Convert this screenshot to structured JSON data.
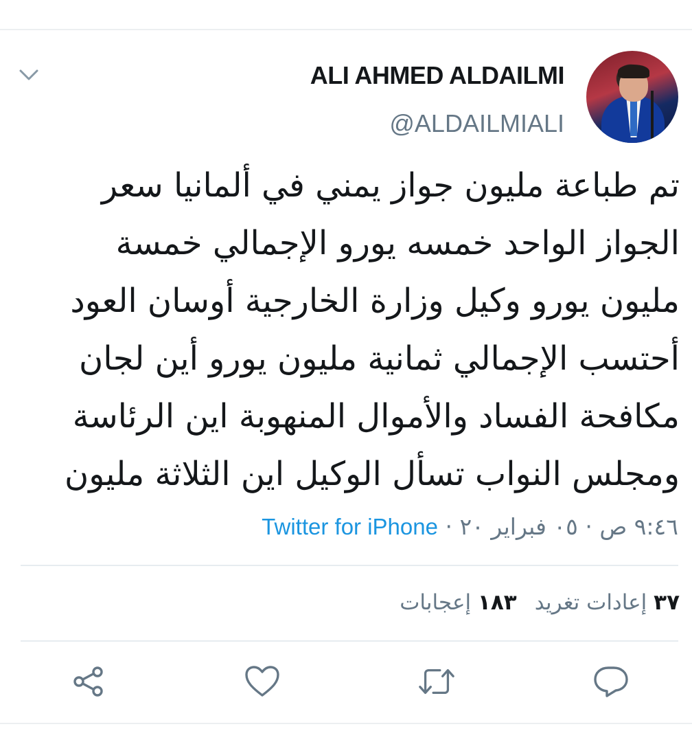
{
  "author": {
    "display_name": "ALI AHMED ALDAILMI",
    "handle": "@ALDAILMIALI"
  },
  "tweet": {
    "lines": [
      "تم طباعة مليون جواز يمني في ألمانيا سعر",
      "الجواز الواحد خمسه يورو الإجمالي خمسة",
      "مليون يورو وكيل وزارة الخارجية أوسان العود",
      "أحتسب الإجمالي ثمانية مليون يورو  أين لجان",
      "مكافحة الفساد والأموال المنهوبة اين الرئاسة",
      "ومجلس النواب تسأل الوكيل اين الثلاثة مليون"
    ]
  },
  "meta": {
    "time": "٩:٤٦ ص",
    "separator": " · ",
    "date": "٠٥ فبراير ٢٠",
    "source": "Twitter for iPhone"
  },
  "stats": {
    "retweets_count": "٣٧",
    "retweets_label": "إعادات تغريد",
    "likes_count": "١٨٣",
    "likes_label": "إعجابات"
  },
  "icons": {
    "menu": "chevron-down-icon",
    "share": "share-icon",
    "like": "heart-icon",
    "retweet": "retweet-icon",
    "reply": "reply-icon",
    "icon_color": "#657786",
    "link_color": "#1b95e0"
  }
}
